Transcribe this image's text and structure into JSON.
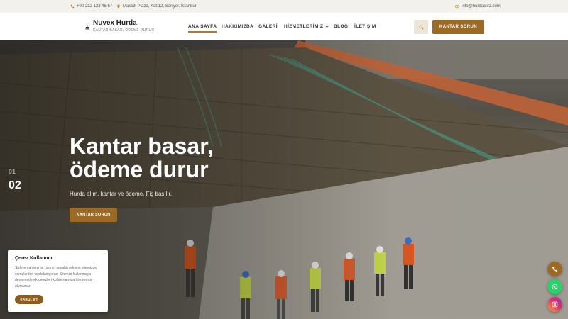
{
  "topbar": {
    "phone": "+90 212 123 45 67",
    "address": "Maslak Plaza, Kat:12, Sarıyer, İstanbul",
    "email": "info@hurdaciv2.com"
  },
  "brand": {
    "name": "Nuvex Hurda",
    "tagline": "KANTAR BASAR, ÖDEME DURUR"
  },
  "nav": {
    "items": [
      {
        "label": "ANA SAYFA",
        "active": true
      },
      {
        "label": "HAKKIMIZDA"
      },
      {
        "label": "GALERİ"
      },
      {
        "label": "HİZMETLERİMİZ",
        "dropdown": true
      },
      {
        "label": "BLOG"
      },
      {
        "label": "İLETİŞİM"
      }
    ],
    "cta_label": "KANTAR SORUN"
  },
  "hero": {
    "title_line1": "Kantar basar,",
    "title_line2": "ödeme durur",
    "subtitle": "Hurda alım, kantar ve ödeme. Fiş basılır.",
    "button_label": "KANTAR SORUN",
    "slide_prev": "01",
    "slide_current": "02"
  },
  "cookie": {
    "title": "Çerez Kullanımı",
    "text": "Sizlere daha iyi bir hizmet sunabilmek için sitemizde çerezlerden faydalanıyoruz. Sitemizi kullanmaya devam ederek çerezleri kullanmamıza izin vermiş olursunuz.",
    "accept_label": "KABUL ET"
  },
  "icons": {
    "phone": "phone-icon",
    "location": "map-pin-icon",
    "email": "envelope-icon",
    "search": "search-icon",
    "whatsapp": "whatsapp-icon",
    "instagram": "instagram-icon"
  },
  "colors": {
    "accent": "#9b6a25",
    "whatsapp": "#25d366"
  }
}
